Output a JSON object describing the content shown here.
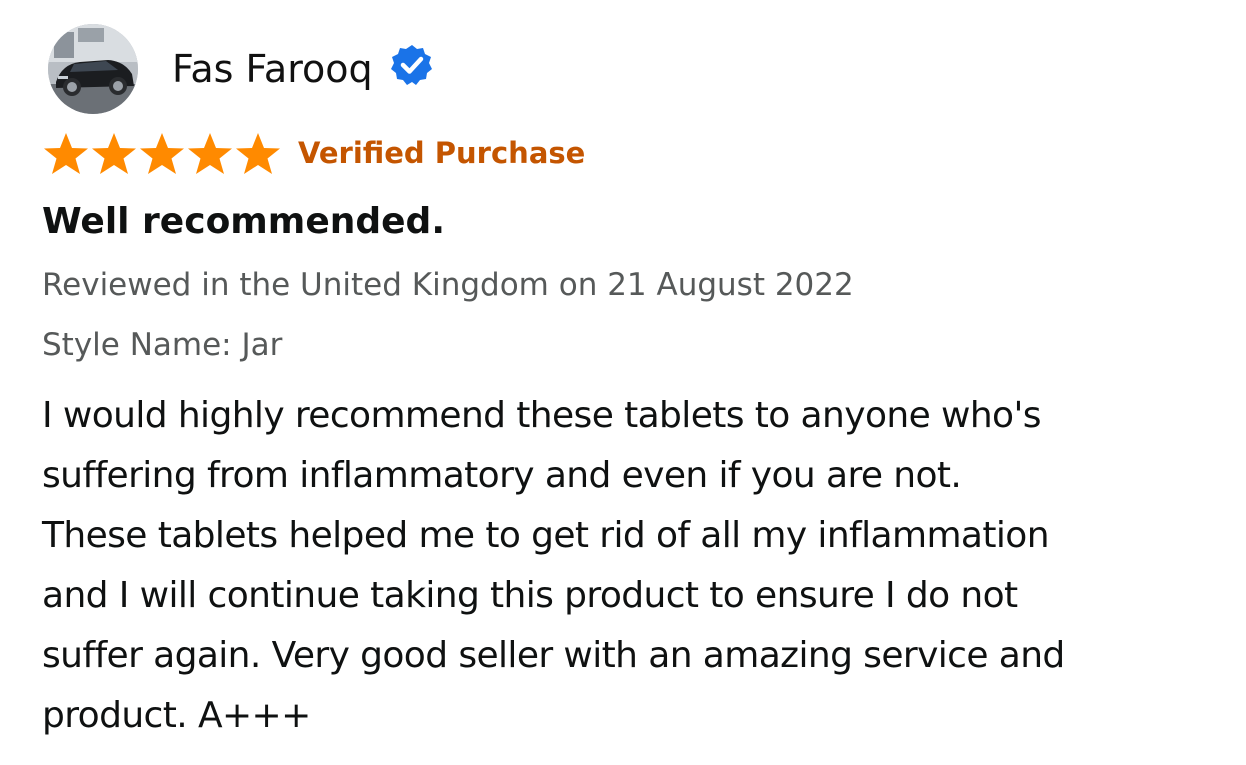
{
  "reviewer": {
    "name": "Fas Farooq",
    "avatar_icon": "car-avatar-image",
    "badge_icon": "verified-check-icon",
    "badge_color": "#1a73e8"
  },
  "rating": {
    "stars": 5,
    "max_stars": 5,
    "star_color": "#ff8a00",
    "verified_label": "Verified Purchase",
    "verified_color": "#c45500"
  },
  "review": {
    "title": "Well recommended.",
    "date_line": "Reviewed in the United Kingdom on 21 August 2022",
    "style_line": "Style Name: Jar",
    "body_lines": [
      "I would highly recommend these tablets to anyone who's",
      "suffering from inflammatory and even if you are not.",
      "These tablets helped me to get rid of all my inflammation",
      "and I will continue taking this product to ensure I do not",
      "suffer again. Very good seller with an amazing service and",
      "product. A+++"
    ]
  }
}
